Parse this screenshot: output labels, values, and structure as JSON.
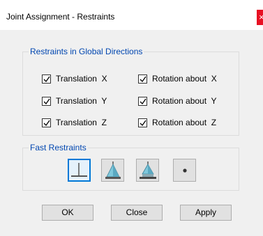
{
  "window": {
    "title": "Joint Assignment - Restraints",
    "close_glyph": "×"
  },
  "restraints_group": {
    "label": "Restraints in Global Directions",
    "items": [
      {
        "label": "Translation  X",
        "checked": true
      },
      {
        "label": "Rotation about  X",
        "checked": true
      },
      {
        "label": "Translation  Y",
        "checked": true
      },
      {
        "label": "Rotation about  Y",
        "checked": true
      },
      {
        "label": "Translation  Z",
        "checked": true
      },
      {
        "label": "Rotation about  Z",
        "checked": true
      }
    ]
  },
  "fast_restraints_group": {
    "label": "Fast Restraints",
    "buttons": [
      {
        "icon": "free-joint-icon",
        "selected": true
      },
      {
        "icon": "pin-support-icon",
        "selected": false
      },
      {
        "icon": "fixed-support-icon",
        "selected": false
      },
      {
        "icon": "roller-support-icon",
        "selected": false
      }
    ]
  },
  "buttons": {
    "ok": "OK",
    "close": "Close",
    "apply": "Apply"
  },
  "colors": {
    "group_label": "#0046b0",
    "selected_border": "#0078d7",
    "close_button": "#e81123"
  }
}
